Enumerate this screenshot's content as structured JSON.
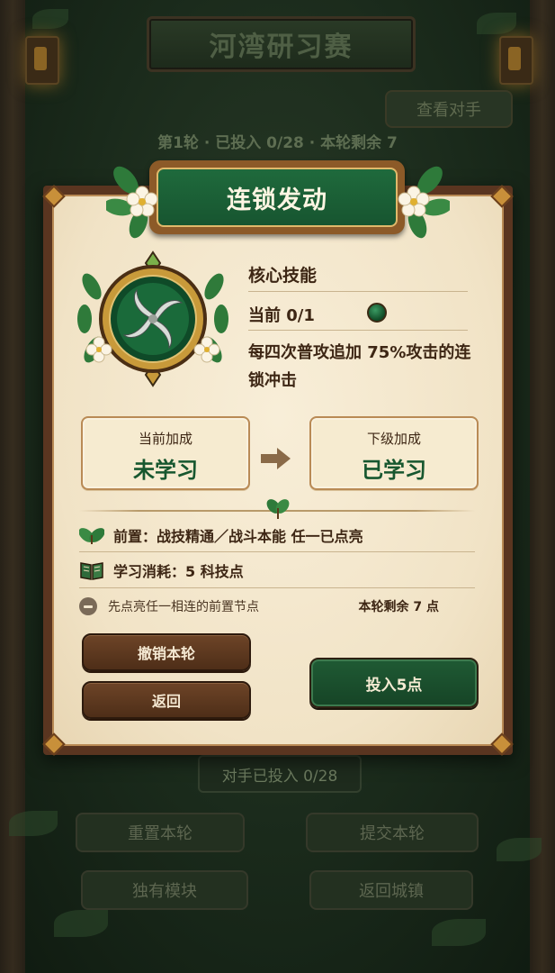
{
  "background": {
    "title": "河湾研习赛",
    "view_opponent": "查看对手",
    "round_status": "第1轮 · 已投入 0/28 · 本轮剩余 7",
    "opponent_invested": "对手已投入 0/28",
    "buttons": {
      "reset_round": "重置本轮",
      "submit_round": "提交本轮",
      "unique_modules": "独有模块",
      "return_town": "返回城镇"
    }
  },
  "modal": {
    "title": "连锁发动",
    "skill_type": "核心技能",
    "level": "当前 0/1",
    "description": "每四次普攻追加 75%攻击的连锁冲击",
    "current_bonus": {
      "label": "当前加成",
      "value": "未学习"
    },
    "next_bonus": {
      "label": "下级加成",
      "value": "已学习"
    },
    "prerequisite": "前置：战技精通／战斗本能 任一已点亮",
    "cost": "学习消耗：5 科技点",
    "hint": "先点亮任一相连的前置节点",
    "round_remaining": "本轮剩余 7 点",
    "buttons": {
      "undo_round": "撤销本轮",
      "back": "返回",
      "invest": "投入5点"
    }
  },
  "colors": {
    "accent_green": "#17572f",
    "parchment": "#f1e3c6",
    "wood": "#5a3520"
  }
}
